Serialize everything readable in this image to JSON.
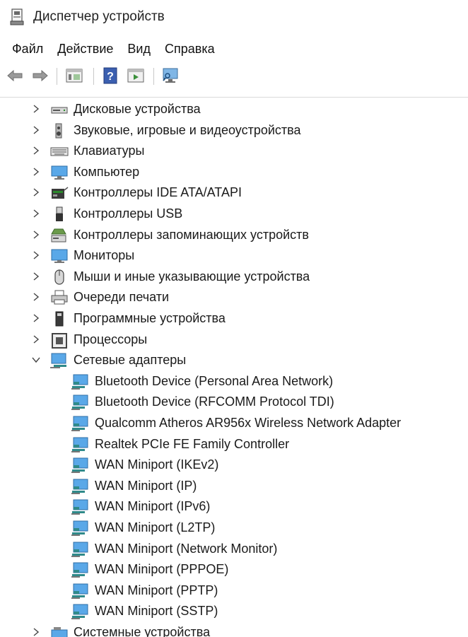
{
  "window": {
    "title": "Диспетчер устройств"
  },
  "menu": [
    "Файл",
    "Действие",
    "Вид",
    "Справка"
  ],
  "toolbar": [
    "back-icon",
    "forward-icon",
    "properties-icon",
    "help-icon",
    "run-icon",
    "monitor-scan-icon"
  ],
  "tree": {
    "categories": [
      {
        "label": "Дисковые устройства",
        "icon": "disk-drive-icon",
        "expanded": false
      },
      {
        "label": "Звуковые, игровые и видеоустройства",
        "icon": "speaker-icon",
        "expanded": false
      },
      {
        "label": "Клавиатуры",
        "icon": "keyboard-icon",
        "expanded": false
      },
      {
        "label": "Компьютер",
        "icon": "computer-icon",
        "expanded": false
      },
      {
        "label": "Контроллеры IDE ATA/ATAPI",
        "icon": "ide-controller-icon",
        "expanded": false
      },
      {
        "label": "Контроллеры USB",
        "icon": "usb-icon",
        "expanded": false
      },
      {
        "label": "Контроллеры запоминающих устройств",
        "icon": "storage-controller-icon",
        "expanded": false
      },
      {
        "label": "Мониторы",
        "icon": "monitor-icon",
        "expanded": false
      },
      {
        "label": "Мыши и иные указывающие устройства",
        "icon": "mouse-icon",
        "expanded": false
      },
      {
        "label": "Очереди печати",
        "icon": "printer-icon",
        "expanded": false
      },
      {
        "label": "Программные устройства",
        "icon": "software-device-icon",
        "expanded": false
      },
      {
        "label": "Процессоры",
        "icon": "processor-icon",
        "expanded": false
      },
      {
        "label": "Сетевые адаптеры",
        "icon": "network-adapter-icon",
        "expanded": true,
        "children": [
          "Bluetooth Device (Personal Area Network)",
          "Bluetooth Device (RFCOMM Protocol TDI)",
          "Qualcomm Atheros AR956x Wireless Network Adapter",
          "Realtek PCIe FE Family Controller",
          "WAN Miniport (IKEv2)",
          "WAN Miniport (IP)",
          "WAN Miniport (IPv6)",
          "WAN Miniport (L2TP)",
          "WAN Miniport (Network Monitor)",
          "WAN Miniport (PPPOE)",
          "WAN Miniport (PPTP)",
          "WAN Miniport (SSTP)"
        ]
      },
      {
        "label": "Системные устройства",
        "icon": "system-device-icon",
        "expanded": false
      }
    ]
  }
}
